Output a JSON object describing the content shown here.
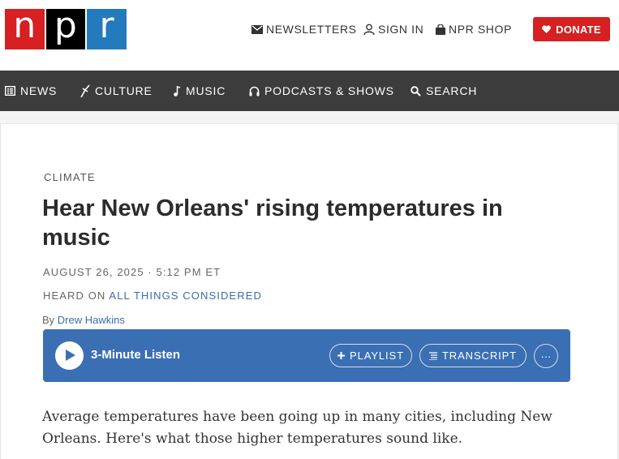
{
  "logo": {
    "letters": [
      "n",
      "p",
      "r"
    ],
    "colors": [
      "#d62021",
      "#000000",
      "#237bbd"
    ]
  },
  "header": {
    "newsletters": "NEWSLETTERS",
    "sign_in": "SIGN IN",
    "shop": "NPR SHOP",
    "donate": "DONATE"
  },
  "nav": {
    "items": [
      {
        "label": "NEWS",
        "icon": "news-icon"
      },
      {
        "label": "CULTURE",
        "icon": "culture-icon"
      },
      {
        "label": "MUSIC",
        "icon": "music-note-icon"
      },
      {
        "label": "PODCASTS & SHOWS",
        "icon": "headphones-icon"
      },
      {
        "label": "SEARCH",
        "icon": "search-icon"
      }
    ]
  },
  "article": {
    "slug": "CLIMATE",
    "title": "Hear New Orleans' rising temperatures in music",
    "date": "AUGUST 26, 2025 · 5:12 PM ET",
    "heard_prefix": "HEARD ON",
    "show": "ALL THINGS CONSIDERED",
    "by": "By",
    "author": "Drew Hawkins",
    "body": "Average temperatures have been going up in many cities, including New Orleans. Here's what those higher temperatures sound like."
  },
  "player": {
    "listen": "3-Minute Listen",
    "playlist": "PLAYLIST",
    "transcript": "TRANSCRIPT",
    "more": "···"
  },
  "colors": {
    "accent_red": "#d62021",
    "player_blue": "#3b6fb3",
    "nav_bg": "#3c3c3c",
    "link_blue": "#3d6ab1"
  }
}
